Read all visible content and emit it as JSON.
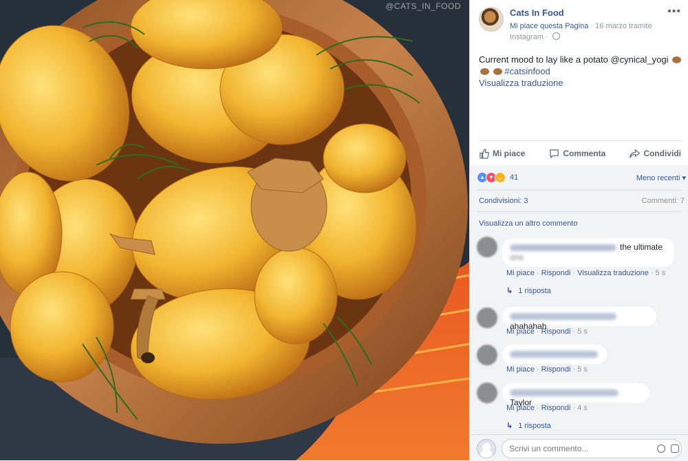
{
  "photo": {
    "watermark": "@CATS_IN_FOOD",
    "description_icon": "photo-image"
  },
  "post": {
    "page_name": "Cats In Food",
    "like_page": "Mi piace questa Pagina",
    "date_via": "16 marzo tramite",
    "source": "Instagram",
    "text": "Current mood to lay like a potato @cynical_yogi",
    "hashtag": "#catsinfood",
    "translate": "Visualizza traduzione"
  },
  "actions": {
    "like": "Mi piace",
    "comment": "Commenta",
    "share": "Condividi"
  },
  "stats": {
    "reaction_count": "41",
    "sort": "Meno recenti",
    "shares": "Condivisioni: 3",
    "comments": "Commenti: 7",
    "view_more": "Visualizza un altro commento"
  },
  "comments": [
    {
      "text": "the ultimate",
      "text2": "one",
      "like": "Mi piace",
      "reply": "Rispondi",
      "translate": "Visualizza traduzione",
      "time": "5 s",
      "replies": "1 risposta"
    },
    {
      "text": "ahahahah",
      "like": "Mi piace",
      "reply": "Rispondi",
      "time": "5 s"
    },
    {
      "text": "",
      "like": "Mi piace",
      "reply": "Rispondi",
      "time": "5 s"
    },
    {
      "text": "Taylor",
      "like": "Mi piace",
      "reply": "Rispondi",
      "time": "4 s",
      "replies": "1 risposta"
    }
  ],
  "composer": {
    "placeholder": "Scrivi un commento..."
  },
  "colors": {
    "link": "#365899",
    "muted": "#90949c",
    "panel_bg": "#f2f3f5"
  }
}
